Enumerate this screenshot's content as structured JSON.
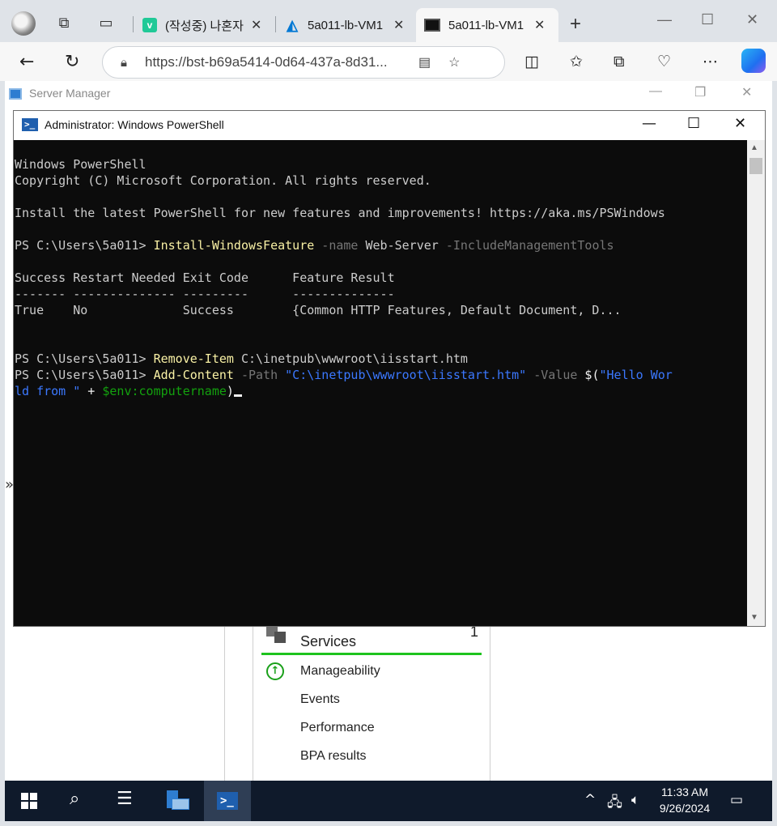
{
  "browser": {
    "tabs": [
      {
        "label": "(작성중) 나혼자",
        "favicon": "v-icon",
        "color": "#20c997"
      },
      {
        "label": "5a011-lb-VM1",
        "favicon": "azure-icon",
        "color": "#0078d4"
      },
      {
        "label": "5a011-lb-VM1",
        "favicon": "terminal-icon",
        "color": "#111111"
      }
    ],
    "url": "https://bst-b69a5414-0d64-437a-8d31..."
  },
  "server_manager": {
    "title": "Server Manager",
    "services": {
      "name": "Services",
      "count": "1",
      "items": [
        "Manageability",
        "Events",
        "Performance",
        "BPA results"
      ]
    }
  },
  "powershell": {
    "title": "Administrator: Windows PowerShell",
    "lines": {
      "l1": "Windows PowerShell",
      "l2": "Copyright (C) Microsoft Corporation. All rights reserved.",
      "l3": "Install the latest PowerShell for new features and improvements! https://aka.ms/PSWindows",
      "prompt": "PS C:\\Users\\5a011> ",
      "cmd1": "Install-WindowsFeature",
      "cmd1_p1": " -name",
      "cmd1_v1": " Web-Server",
      "cmd1_p2": " -IncludeManagementTools",
      "hdr": "Success Restart Needed Exit Code      Feature Result",
      "dash": "------- -------------- ---------      --------------",
      "row": "True    No             Success        {Common HTTP Features, Default Document, D...",
      "cmd2": "Remove-Item",
      "cmd2_arg": " C:\\inetpub\\wwwroot\\iisstart.htm",
      "cmd3": "Add-Content",
      "cmd3_p1": " -Path",
      "cmd3_v1": " \"C:\\inetpub\\wwwroot\\iisstart.htm\"",
      "cmd3_p2": " -Value",
      "cmd3_v2": " $(",
      "cmd3_v3": "\"Hello Wor",
      "cont_a": "ld from \"",
      "cont_b": " + ",
      "cont_c": "$env:computername",
      "cont_d": ")"
    }
  },
  "taskbar": {
    "time": "11:33 AM",
    "date": "9/26/2024"
  }
}
